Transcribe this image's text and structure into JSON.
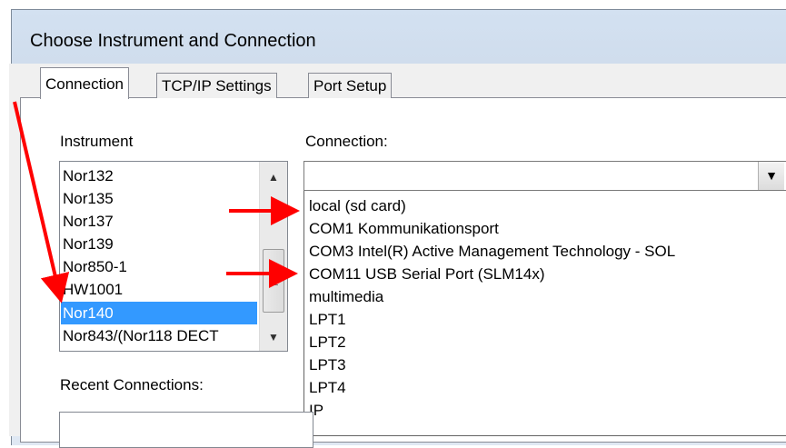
{
  "window": {
    "title": "Choose Instrument and Connection"
  },
  "tabs": [
    {
      "label": "Connection",
      "active": true
    },
    {
      "label": "TCP/IP Settings",
      "active": false
    },
    {
      "label": "Port Setup",
      "active": false
    }
  ],
  "instrument": {
    "label": "Instrument",
    "items": [
      "Nor132",
      "Nor135",
      "Nor137",
      "Nor139",
      "Nor850-1",
      "HW1001",
      "Nor140",
      "Nor843/(Nor118 DECT"
    ],
    "selected": "Nor140"
  },
  "connection": {
    "label": "Connection:",
    "value": "",
    "options": [
      "local (sd card)",
      "COM1 Kommunikationsport",
      "COM3 Intel(R) Active Management Technology - SOL",
      "COM11 USB Serial Port (SLM14x)",
      "multimedia",
      "LPT1",
      "LPT2",
      "LPT3",
      "LPT4",
      "IP"
    ]
  },
  "recent": {
    "label": "Recent Connections:"
  },
  "icons": {
    "scroll_up": "chevron-up-icon",
    "scroll_down": "chevron-down-icon",
    "dropdown": "chevron-down-icon"
  },
  "colors": {
    "selection": "#3399ff",
    "annotation": "#ff0000",
    "titlebar": "#d3e1f1"
  }
}
